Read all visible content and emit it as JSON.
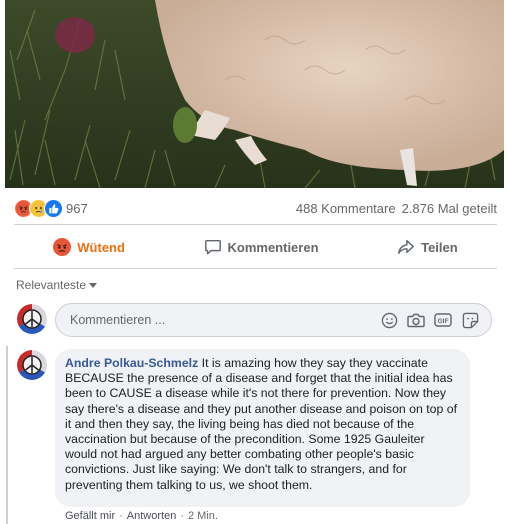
{
  "post": {
    "reactions": {
      "icons": [
        "angry-face",
        "sad-face",
        "like-thumb"
      ],
      "count": "967"
    },
    "comments_count": "488 Kommentare",
    "shares_count": "2.876 Mal geteilt"
  },
  "actions": {
    "react_label": "Wütend",
    "comment_label": "Kommentieren",
    "share_label": "Teilen"
  },
  "comments_section": {
    "sort_label": "Relevanteste",
    "composer_placeholder": "Kommentieren ...",
    "composer_icons": [
      "emoji-icon",
      "camera-icon",
      "gif-icon",
      "sticker-icon"
    ]
  },
  "comment": {
    "author": "Andre Polkau-Schmelz",
    "text": " It is amazing how they say they vaccinate BECAUSE the presence of a disease and forget that the initial idea has been to CAUSE a disease while it's not there for prevention. Now they say there's a disease and they put another disease and poison on top of it and then they say, the living being has died not because of the vaccination but because of the precondition. Some 1925 Gauleiter would not had argued any better combating other people's basic convictions. Just like saying: We don't talk to strangers, and for preventing them talking to us, we shoot them.",
    "like_label": "Gefällt mir",
    "reply_label": "Antworten",
    "time": "2 Min."
  },
  "colors": {
    "accent_angry": "#e9710f",
    "link_blue": "#385898",
    "muted": "#65676b",
    "bubble_bg": "#f0f2f5"
  }
}
